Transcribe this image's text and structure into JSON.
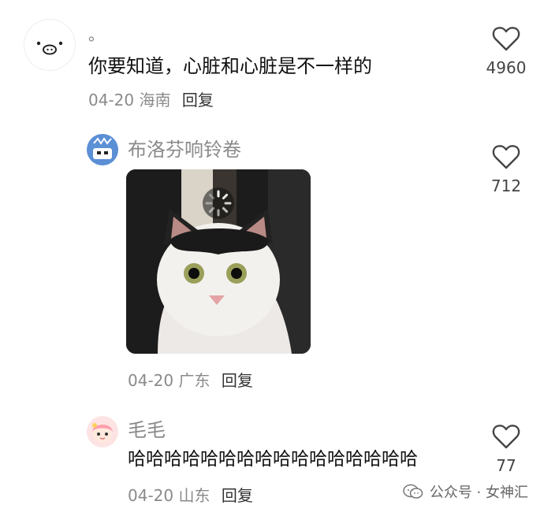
{
  "comments": [
    {
      "username": "。",
      "text": "你要知道，心脏和心脏是不一样的",
      "date": "04-20",
      "location": "海南",
      "reply_label": "回复",
      "likes": "4960",
      "avatar_icon": "pig-face-icon"
    },
    {
      "username": "布洛芬响铃卷",
      "text": "",
      "date": "04-20",
      "location": "广东",
      "reply_label": "回复",
      "likes": "712",
      "avatar_icon": "cartoon-face-icon",
      "image": "cat-photo"
    },
    {
      "username": "毛毛",
      "text": "哈哈哈哈哈哈哈哈哈哈哈哈哈哈哈哈",
      "date": "04-20",
      "location": "山东",
      "reply_label": "回复",
      "likes": "77",
      "avatar_icon": "anime-girl-icon"
    }
  ],
  "watermark": {
    "text": "公众号 · 女神汇",
    "icon": "wechat-icon"
  },
  "colors": {
    "muted": "#8a8a8a",
    "text": "#111111",
    "background": "#ffffff"
  }
}
